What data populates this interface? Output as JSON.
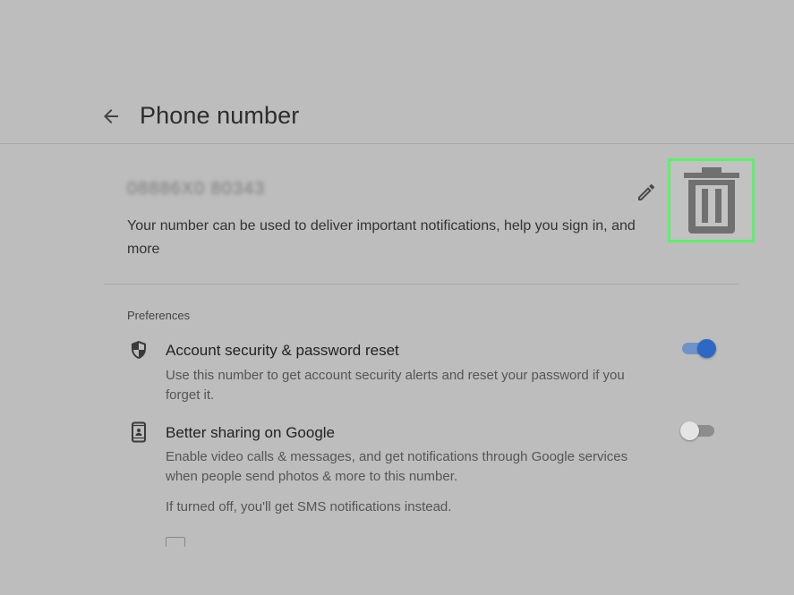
{
  "header": {
    "title": "Phone number"
  },
  "phone": {
    "value": "08886X0 80343",
    "description_line1": "Your number can be used to deliver important notifications, help you sign in, and",
    "description_line2": "more"
  },
  "preferences": {
    "label": "Preferences",
    "items": [
      {
        "title": "Account security & password reset",
        "desc_line1": "Use this number to get account security alerts and reset your password if you",
        "desc_line2": "forget it.",
        "enabled": true
      },
      {
        "title": "Better sharing on Google",
        "desc_line1": "Enable video calls & messages, and get notifications through Google services",
        "desc_line2": "when people send photos & more to this number.",
        "note": "If turned off, you'll get SMS notifications instead.",
        "enabled": false
      }
    ]
  },
  "icons": {
    "back": "arrow-left-icon",
    "edit": "pencil-icon",
    "delete": "trash-icon",
    "security": "shield-icon",
    "sharing": "phone-icon"
  },
  "colors": {
    "highlight": "#5cf06a",
    "toggle_on": "#2d68c4",
    "background": "#bdbdbd"
  }
}
